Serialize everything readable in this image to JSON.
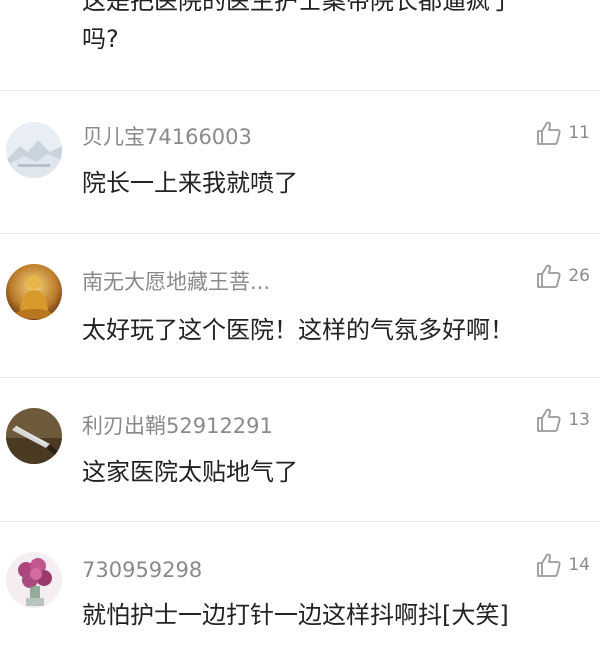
{
  "top_comment": {
    "line1": "这是把医院的医生护士案带院长都逼疯了",
    "line2": "吗?"
  },
  "comments": [
    {
      "username": "贝儿宝74166003",
      "text": "院长一上来我就喷了",
      "likes": "11",
      "avatar_icon": "snowy-mountain-avatar-icon"
    },
    {
      "username": "南无大愿地藏王菩...",
      "text": "太好玩了这个医院！这样的气氛多好啊！",
      "likes": "26",
      "avatar_icon": "golden-buddha-avatar-icon"
    },
    {
      "username": "利刃出鞘52912291",
      "text": "这家医院太贴地气了",
      "likes": "13",
      "avatar_icon": "blade-avatar-icon"
    },
    {
      "username": "730959298",
      "text": "就怕护士一边打针一边这样抖啊抖[大笑]",
      "likes": "14",
      "avatar_icon": "flower-bouquet-avatar-icon"
    }
  ],
  "colors": {
    "username": "#8a8a8a",
    "text": "#222222",
    "divider": "#e6e6e6"
  }
}
